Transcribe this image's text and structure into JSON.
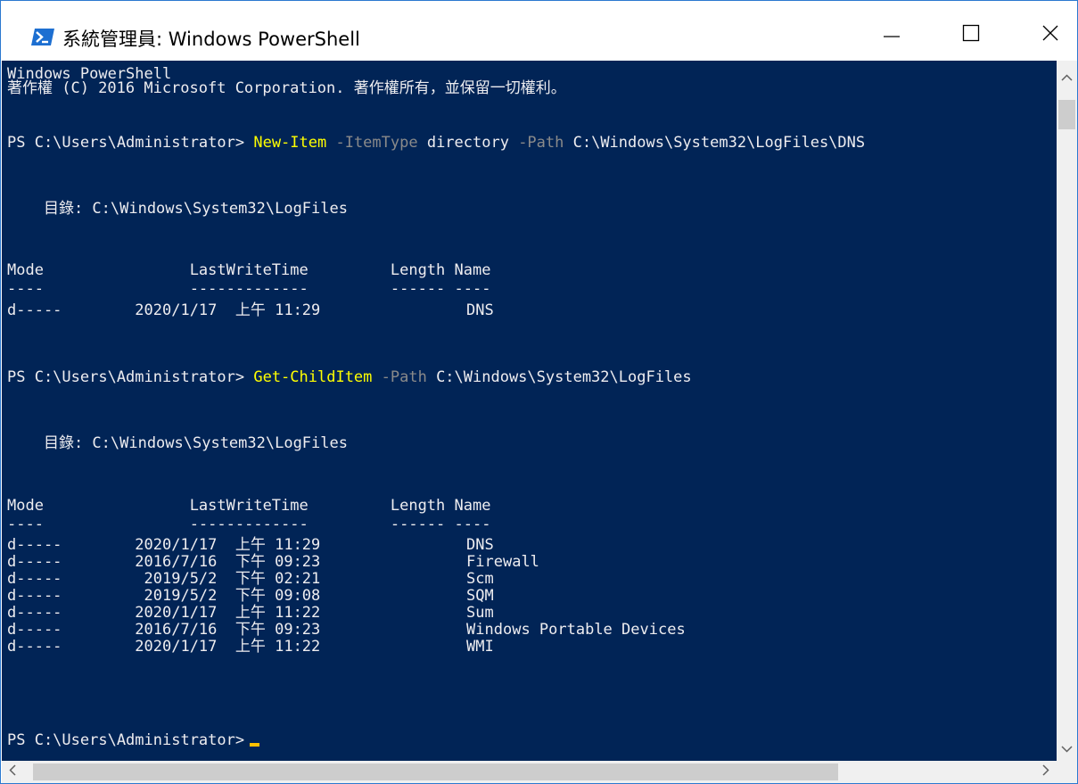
{
  "window": {
    "title": "系統管理員: Windows PowerShell",
    "icon": "powershell-icon",
    "controls": {
      "minimize": "minimize-icon",
      "maximize": "maximize-icon",
      "close": "close-icon"
    }
  },
  "console": {
    "header1": "Windows PowerShell",
    "header2": "著作權 (C) 2016 Microsoft Corporation. 著作權所有，並保留一切權利。",
    "cmd1": {
      "prompt": "PS C:\\Users\\Administrator> ",
      "cmdlet": "New-Item",
      "p1": " -ItemType",
      "v1": " directory",
      "p2": " -Path",
      "v2": " C:\\Windows\\System32\\LogFiles\\DNS"
    },
    "dir1": "    目錄: C:\\Windows\\System32\\LogFiles",
    "hdr1": "Mode                LastWriteTime         Length Name",
    "sep1": "----                -------------         ------ ----",
    "rows1": [
      "d-----        2020/1/17  上午 11:29                DNS"
    ],
    "cmd2": {
      "prompt": "PS C:\\Users\\Administrator> ",
      "cmdlet": "Get-ChildItem",
      "p1": " -Path",
      "v1": " C:\\Windows\\System32\\LogFiles"
    },
    "dir2": "    目錄: C:\\Windows\\System32\\LogFiles",
    "hdr2": "Mode                LastWriteTime         Length Name",
    "sep2": "----                -------------         ------ ----",
    "rows2": [
      "d-----        2020/1/17  上午 11:29                DNS",
      "d-----        2016/7/16  下午 09:23                Firewall",
      "d-----         2019/5/2  下午 02:21                Scm",
      "d-----         2019/5/2  下午 09:08                SQM",
      "d-----        2020/1/17  上午 11:22                Sum",
      "d-----        2016/7/16  下午 09:23                Windows Portable Devices",
      "d-----        2020/1/17  上午 11:22                WMI"
    ],
    "prompt_final": "PS C:\\Users\\Administrator>"
  },
  "colors": {
    "console_bg": "#012456",
    "console_text": "#eeedf0",
    "cmdlet": "#ffff00",
    "parameter": "#8a8a8a",
    "cursor": "#ffc000"
  }
}
